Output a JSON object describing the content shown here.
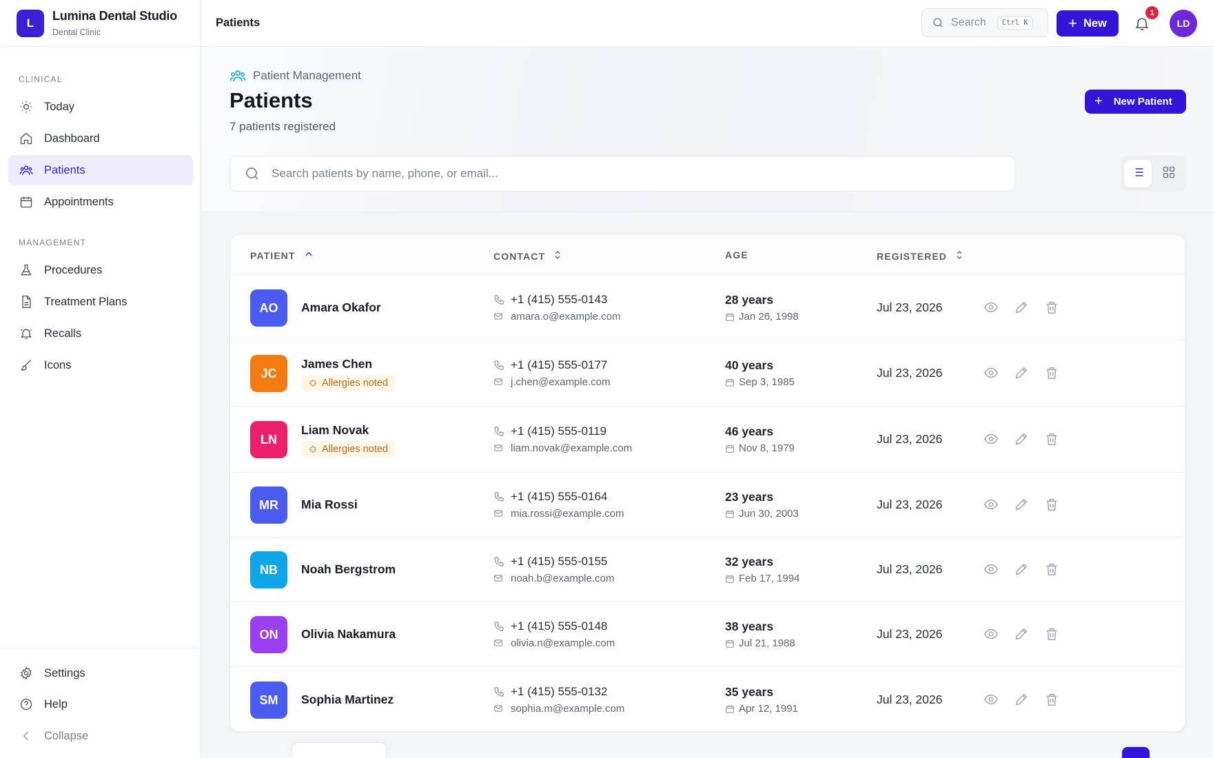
{
  "app": {
    "name": "Lumina Dental Studio",
    "subtitle": "Dental Clinic",
    "logo_letter": "L"
  },
  "sidebar": {
    "sections": [
      {
        "label": "CLINICAL"
      },
      {
        "label": "MANAGEMENT"
      }
    ],
    "items": [
      {
        "label": "Today",
        "icon": "sun-icon"
      },
      {
        "label": "Dashboard",
        "icon": "home-icon"
      },
      {
        "label": "Patients",
        "icon": "users-icon",
        "active": true
      },
      {
        "label": "Appointments",
        "icon": "calendar-icon"
      },
      {
        "label": "Procedures",
        "icon": "flask-icon"
      },
      {
        "label": "Treatment Plans",
        "icon": "document-icon"
      },
      {
        "label": "Recalls",
        "icon": "bell-ring-icon"
      },
      {
        "label": "Icons",
        "icon": "brush-icon"
      }
    ],
    "footer": [
      {
        "label": "Settings",
        "icon": "gear-icon"
      },
      {
        "label": "Help",
        "icon": "help-icon"
      },
      {
        "label": "Collapse",
        "icon": "chevron-left-icon"
      }
    ]
  },
  "topbar": {
    "title": "Patients",
    "search_label": "Search",
    "shortcut": "Ctrl K",
    "new_label": "New",
    "notification_count": "1",
    "user_initials": "LD"
  },
  "header": {
    "eyebrow": "Patient Management",
    "title": "Patients",
    "subtitle": "7 patients registered",
    "new_patient_label": "New Patient",
    "search_placeholder": "Search patients by name, phone, or email..."
  },
  "table": {
    "columns": [
      "PATIENT",
      "CONTACT",
      "AGE",
      "REGISTERED"
    ],
    "rows": [
      {
        "initials": "AO",
        "name": "Amara Okafor",
        "allergy": "",
        "phone": "+1 (415) 555-0143",
        "email": "amara.o@example.com",
        "age": "28 years",
        "dob": "Jan 26, 1998",
        "registered": "Jul 23, 2026",
        "color": "#4a5cf0"
      },
      {
        "initials": "JC",
        "name": "James Chen",
        "allergy": "Allergies noted",
        "phone": "+1 (415) 555-0177",
        "email": "j.chen@example.com",
        "age": "40 years",
        "dob": "Sep 3, 1985",
        "registered": "Jul 23, 2026",
        "color": "#f47a12"
      },
      {
        "initials": "LN",
        "name": "Liam Novak",
        "allergy": "Allergies noted",
        "phone": "+1 (415) 555-0119",
        "email": "liam.novak@example.com",
        "age": "46 years",
        "dob": "Nov 8, 1979",
        "registered": "Jul 23, 2026",
        "color": "#ec1f6b"
      },
      {
        "initials": "MR",
        "name": "Mia Rossi",
        "allergy": "",
        "phone": "+1 (415) 555-0164",
        "email": "mia.rossi@example.com",
        "age": "23 years",
        "dob": "Jun 30, 2003",
        "registered": "Jul 23, 2026",
        "color": "#4a5cf0"
      },
      {
        "initials": "NB",
        "name": "Noah Bergstrom",
        "allergy": "",
        "phone": "+1 (415) 555-0155",
        "email": "noah.b@example.com",
        "age": "32 years",
        "dob": "Feb 17, 1994",
        "registered": "Jul 23, 2026",
        "color": "#0ea5e9"
      },
      {
        "initials": "ON",
        "name": "Olivia Nakamura",
        "allergy": "",
        "phone": "+1 (415) 555-0148",
        "email": "olivia.n@example.com",
        "age": "38 years",
        "dob": "Jul 21, 1988",
        "registered": "Jul 23, 2026",
        "color": "#9b3ef0"
      },
      {
        "initials": "SM",
        "name": "Sophia Martinez",
        "allergy": "",
        "phone": "+1 (415) 555-0132",
        "email": "sophia.m@example.com",
        "age": "35 years",
        "dob": "Apr 12, 1991",
        "registered": "Jul 23, 2026",
        "color": "#4a5cf0"
      }
    ]
  },
  "colors": {
    "accent": "#3414d8",
    "active_bg": "#eeecfd",
    "badge": "#e5243b"
  }
}
